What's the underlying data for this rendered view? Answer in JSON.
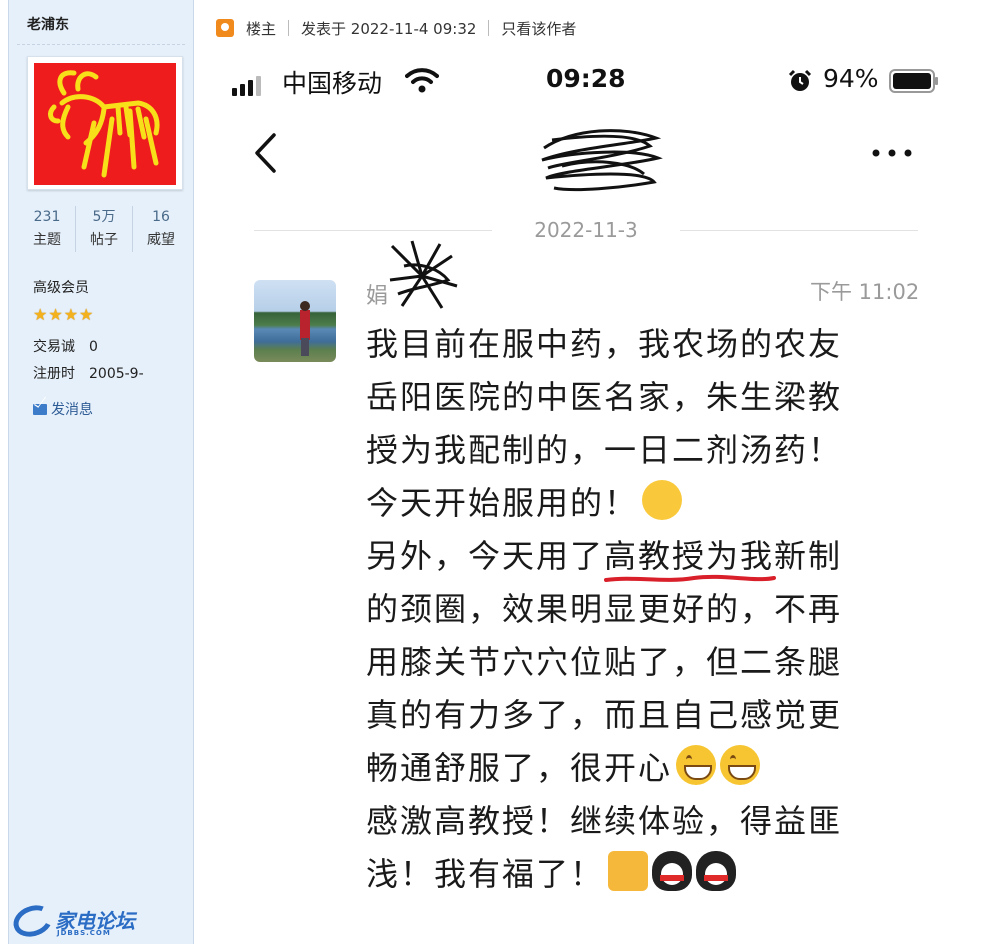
{
  "sidebar": {
    "username": "老浦东",
    "stats": [
      {
        "value": "231",
        "label": "主题"
      },
      {
        "value": "5万",
        "label": "帖子"
      },
      {
        "value": "16",
        "label": "威望"
      }
    ],
    "level": "高级会员",
    "star_count": 4,
    "trade_label": "交易诚",
    "trade_value": "0",
    "register_label": "注册时",
    "register_value": "2005-9-",
    "send_message": "发消息",
    "site_name": "家电论坛",
    "site_domain": "JDBBS.COM"
  },
  "post_header": {
    "owner": "楼主",
    "posted": "发表于 2022-11-4 09:32",
    "only_author": "只看该作者"
  },
  "phone": {
    "status": {
      "carrier": "中国移动",
      "time": "09:28",
      "battery": "94%"
    },
    "date": "2022-11-3",
    "message": {
      "sender_visible": "娟",
      "time": "下午 11:02",
      "lines": [
        "我目前在服中药，我农场的农友",
        "岳阳医院的中医名家，朱生梁教",
        "授为我配制的，一日二剂汤药！",
        "今天开始服用的！",
        "另外，今天用了高教授为我新制",
        "的颈圈，效果明显更好的，不再",
        "用膝关节穴穴位贴了，但二条腿",
        "真的有力多了，而且自己感觉更",
        "畅通舒服了，很开心",
        "感激高教授！继续体验，得益匪",
        "浅！我有福了！"
      ]
    }
  },
  "colors": {
    "sidebar_bg": "#e6f0fa",
    "avatar_red": "#ee1c1c",
    "avatar_gold": "#f7e01a",
    "star": "#f3b21d",
    "link": "#2e5c96",
    "underline_red": "#d9202a"
  },
  "icons": [
    "signal-icon",
    "wifi-icon",
    "alarm-icon",
    "battery-icon",
    "back-icon",
    "more-icon",
    "mail-icon",
    "owner-icon"
  ]
}
